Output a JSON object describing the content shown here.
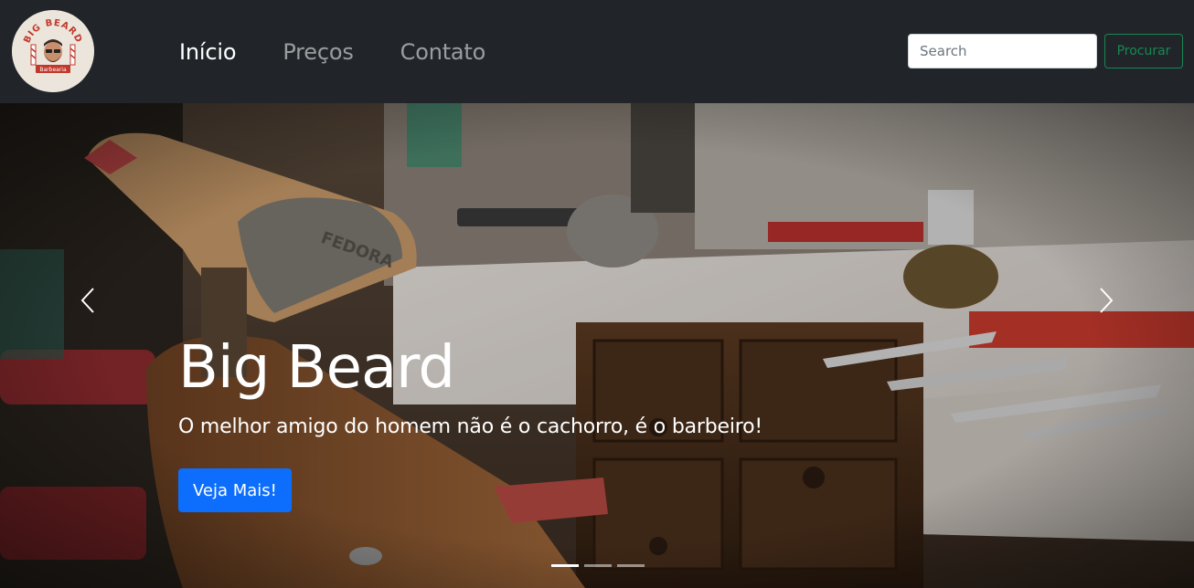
{
  "navbar": {
    "logo": {
      "text_top": "BIG BEARD",
      "text_bottom": "Barbearia"
    },
    "links": [
      {
        "label": "Início",
        "active": true
      },
      {
        "label": "Preços",
        "active": false
      },
      {
        "label": "Contato",
        "active": false
      }
    ],
    "search": {
      "placeholder": "Search",
      "value": "",
      "button_label": "Procurar"
    }
  },
  "carousel": {
    "slide_title": "Big Beard",
    "slide_text": "O melhor amigo do homem não é o cachorro, é o barbeiro!",
    "button_label": "Veja Mais!",
    "prev_icon": "chevron-left-icon",
    "next_icon": "chevron-right-icon",
    "indicator_count": 3,
    "active_indicator": 0
  },
  "colors": {
    "navbar_bg": "#212529",
    "primary": "#0d6efd",
    "success": "#198754"
  }
}
